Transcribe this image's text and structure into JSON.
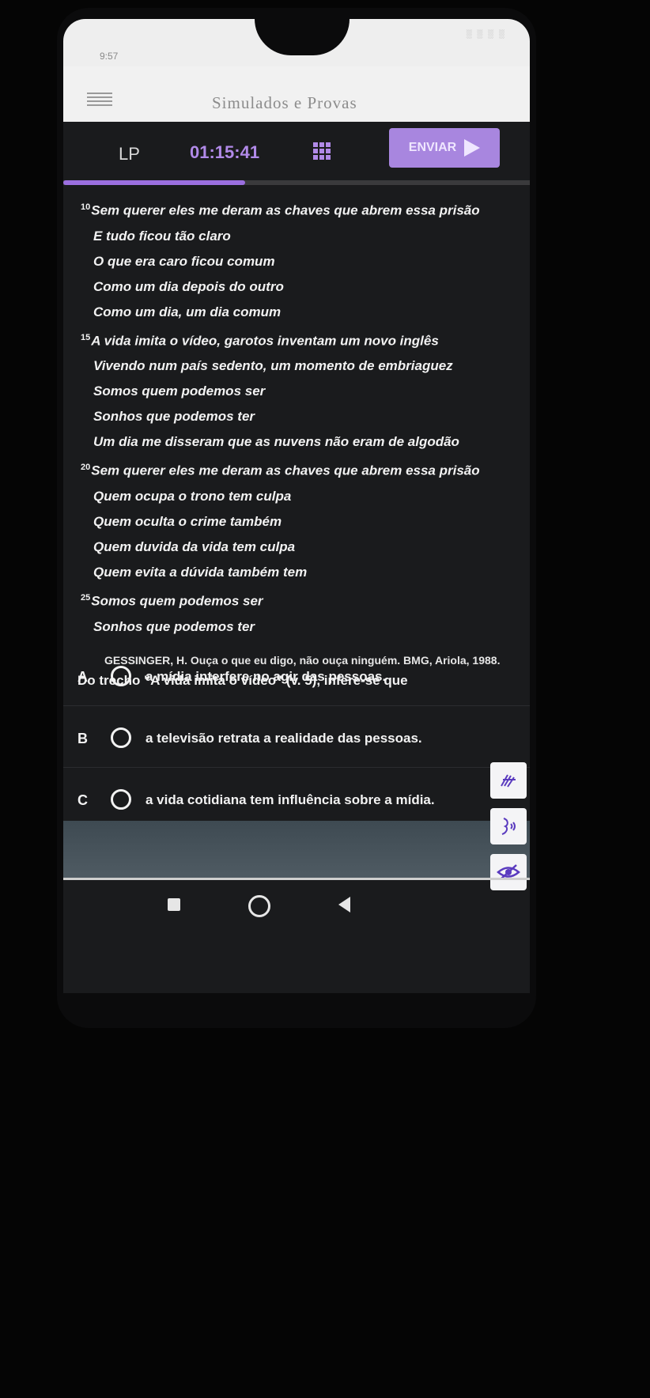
{
  "status_bar": {
    "time": "9:57",
    "icons_text": "░ ░ ░ ░"
  },
  "app": {
    "title": "Simulados e Provas"
  },
  "toolbar": {
    "subject": "LP",
    "timer": "01:15:41",
    "send_label": "ENVIAR"
  },
  "progress": {
    "fraction": 0.39
  },
  "poem": [
    {
      "num": "10",
      "text": "Sem querer eles me deram as chaves que abrem essa prisão"
    },
    {
      "num": "",
      "text": "E tudo ficou tão claro"
    },
    {
      "num": "",
      "text": "O que era caro ficou comum"
    },
    {
      "num": "",
      "text": "Como um dia depois do outro"
    },
    {
      "num": "",
      "text": "Como um dia, um dia comum"
    },
    {
      "num": "15",
      "text": "A vida imita o vídeo, garotos inventam um novo inglês"
    },
    {
      "num": "",
      "text": "Vivendo num país sedento, um momento de embriaguez"
    },
    {
      "num": "",
      "text": "Somos quem podemos ser"
    },
    {
      "num": "",
      "text": "Sonhos que podemos ter"
    },
    {
      "num": "",
      "text": "Um dia me disseram que as nuvens não eram de algodão"
    },
    {
      "num": "20",
      "text": "Sem querer eles me deram as chaves que abrem essa prisão"
    },
    {
      "num": "",
      "text": "Quem ocupa o trono tem culpa"
    },
    {
      "num": "",
      "text": "Quem oculta o crime também"
    },
    {
      "num": "",
      "text": "Quem duvida da vida tem culpa"
    },
    {
      "num": "",
      "text": "Quem evita a dúvida também tem"
    },
    {
      "num": "25",
      "text": "Somos quem podemos ser"
    },
    {
      "num": "",
      "text": "Sonhos que podemos ter"
    }
  ],
  "source": "GESSINGER, H. Ouça o que eu digo, não ouça ninguém. BMG, Ariola, 1988.",
  "question": "Do trecho \"A vida imita o vídeo\" (v. 5), infere-se que",
  "options": [
    {
      "letter": "A",
      "text": "a mídia interfere no agir das pessoas."
    },
    {
      "letter": "B",
      "text": "a televisão retrata a realidade das pessoas."
    },
    {
      "letter": "C",
      "text": "a vida cotidiana tem influência sobre a mídia."
    }
  ],
  "side_tools": [
    "sign-language-icon",
    "audio-speaker-icon",
    "hide-eye-icon"
  ],
  "colors": {
    "accent": "#9b6fe0",
    "send_button": "#a886df",
    "background": "#1a1b1d"
  }
}
